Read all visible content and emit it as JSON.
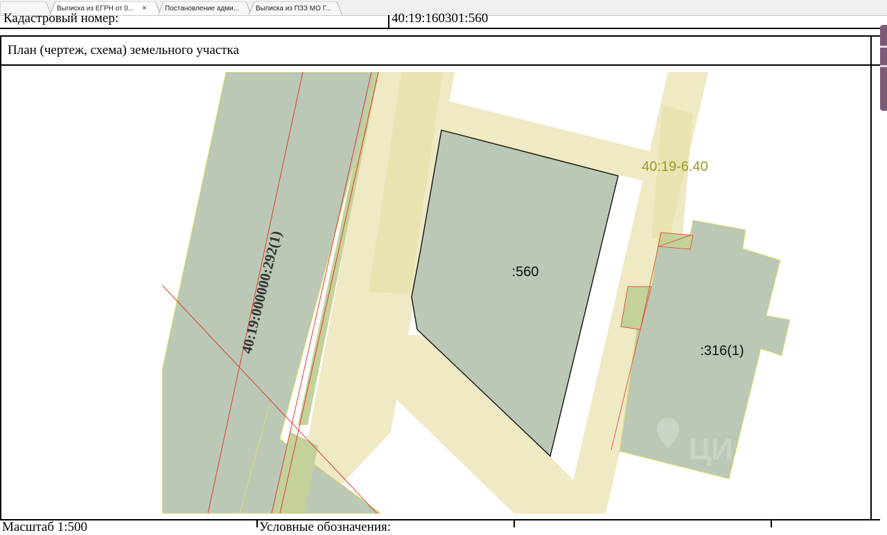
{
  "tabs": [
    {
      "label": "Выписка из ЕГРН от 0...",
      "close": "×",
      "active": true
    },
    {
      "label": "Постановление адми...",
      "active": false
    },
    {
      "label": "Выписка из ПЗЗ МО Г...",
      "active": false
    }
  ],
  "document": {
    "cadastral_label": "Кадастровый номер:",
    "cadastral_value": "40:19:160301:560",
    "plan_title": "План (чертеж, схема) земельного участка",
    "scale_label": "Масштаб 1:500",
    "legend_label": "Условные обозначения:"
  },
  "map": {
    "parcel_main": ":560",
    "parcel_neighbor": ":316(1)",
    "road_label": "40:19:000000:292(1)",
    "zone_label": "40:19-6.40",
    "watermark": "ЦИАН",
    "colors": {
      "parcel_fill": "#bac8b5",
      "zone_fill": "#efe9c4",
      "overlap_fill": "#c4d19a",
      "zone_label": "#9a9a26",
      "boundary_red": "#e03c2c"
    }
  }
}
